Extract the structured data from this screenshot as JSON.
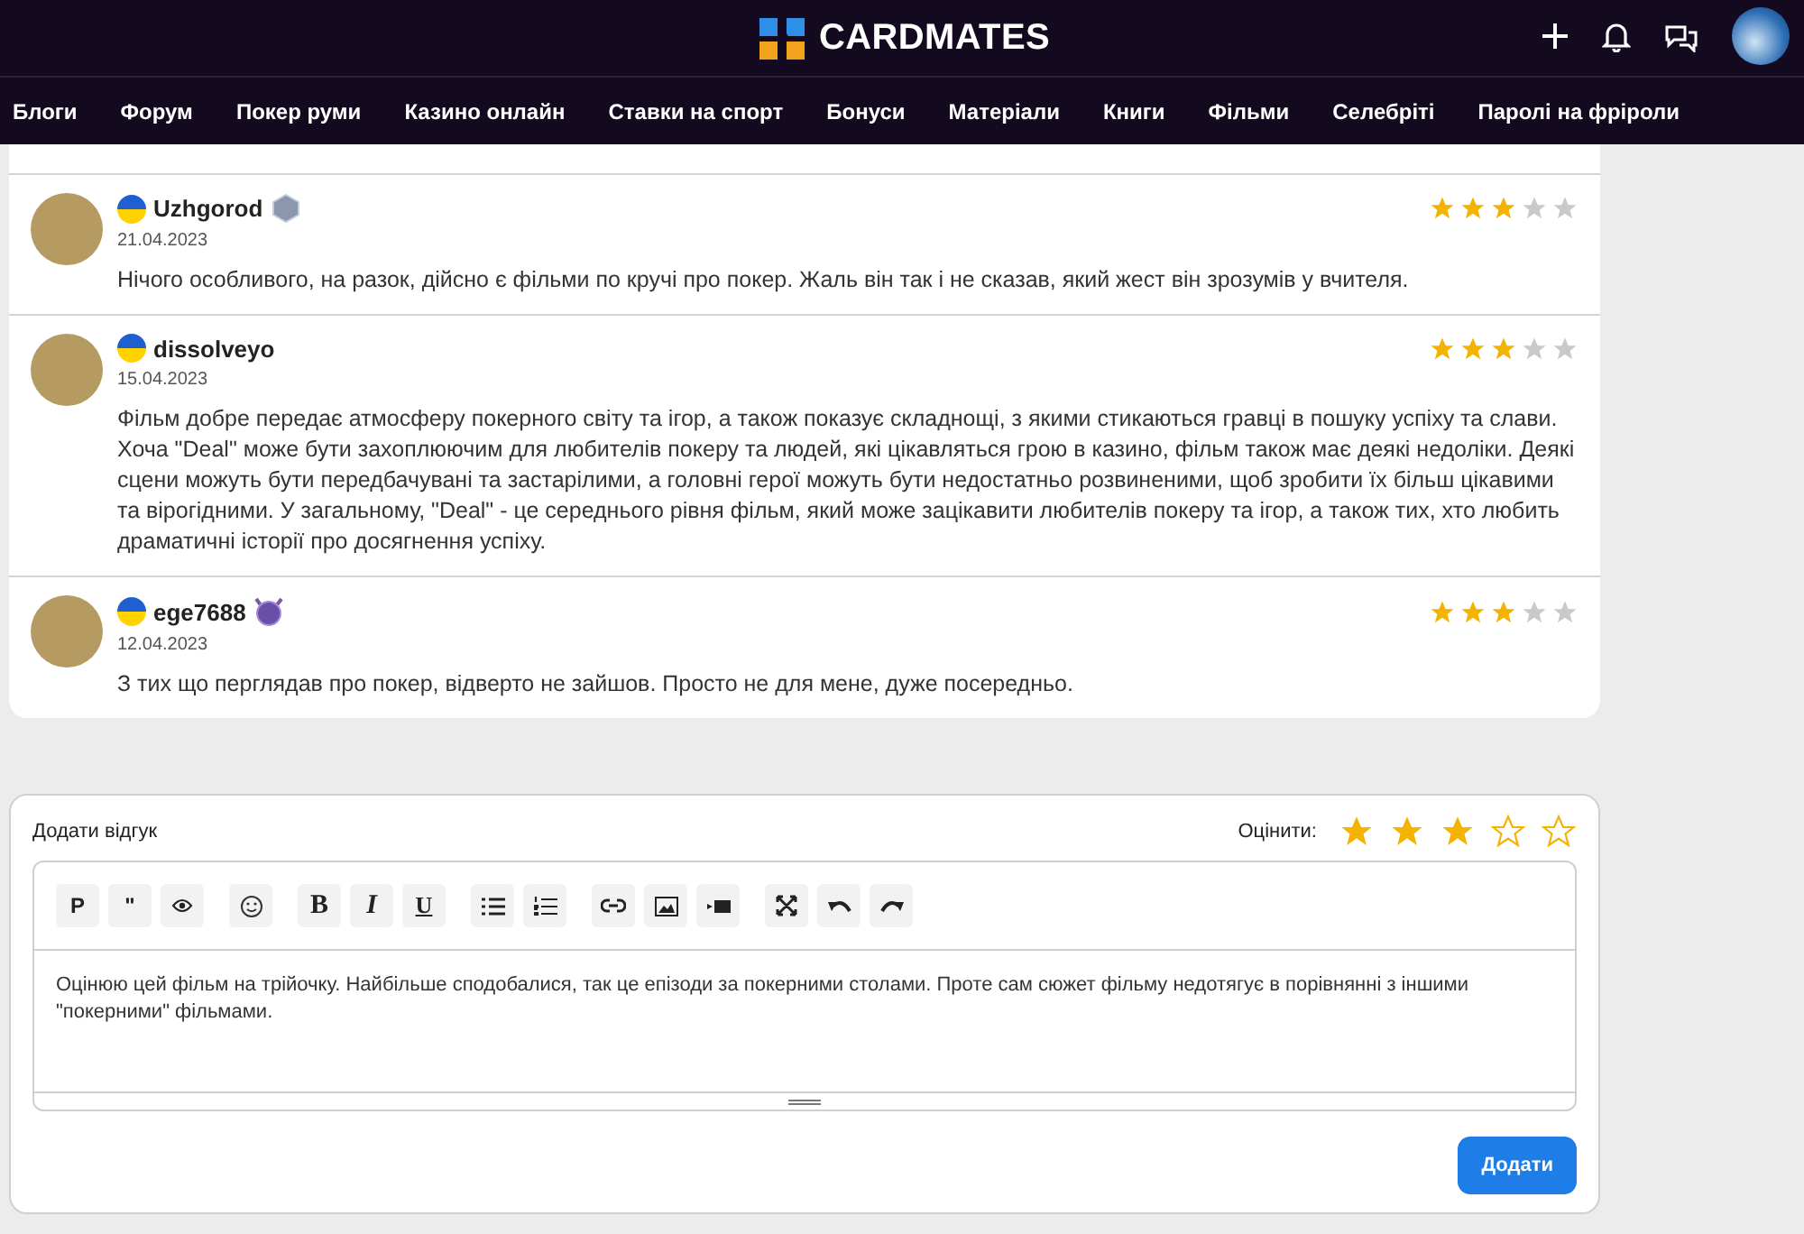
{
  "header": {
    "brand": "CARDMATES"
  },
  "nav": [
    "Блоги",
    "Форум",
    "Покер руми",
    "Казино онлайн",
    "Ставки на спорт",
    "Бонуси",
    "Матеріали",
    "Книги",
    "Фільми",
    "Селебріті",
    "Паролі на фріроли"
  ],
  "reviews": [
    {
      "name": "Uzhgorod",
      "badges": [
        {
          "kind": "shield"
        }
      ],
      "date": "21.04.2023",
      "stars": 3,
      "text": "Нічого особливого, на разок, дійсно є фільми по кручі про покер. Жаль він так і не сказав, який жест він зрозумів у вчителя."
    },
    {
      "name": "dissolveyo",
      "date": "15.04.2023",
      "stars": 3,
      "text": "Фільм добре передає атмосферу покерного світу та ігор, а також показує складнощі, з якими стикаються гравці в пошуку успіху та слави. Хоча \"Deal\" може бути захоплюючим для любителів покеру та людей, які цікавляться грою в казино, фільм також має деякі недоліки. Деякі сцени можуть бути передбачувані та застарілими, а головні герої можуть бути недостатньо розвиненими, щоб зробити їх більш цікавими та вірогідними. У загальному, \"Deal\" - це середнього рівня фільм, який може зацікавити любителів покеру та ігор, а також тих, хто любить драматичні історії про досягнення успіху."
    },
    {
      "name": "ege7688",
      "badges": [
        {
          "kind": "emblem"
        }
      ],
      "date": "12.04.2023",
      "stars": 3,
      "text": "З тих що перглядав про покер, відверто не зайшов. Просто не для мене, дуже посередньо."
    }
  ],
  "review_form": {
    "title": "Додати відгук",
    "rating_label": "Оцінити:",
    "stars": 3,
    "toolbar": [
      [
        {
          "kind": "plain",
          "label": "P"
        },
        {
          "kind": "plain",
          "label": "\""
        },
        {
          "kind": "eye"
        }
      ],
      [
        {
          "kind": "smiley"
        }
      ],
      [
        {
          "kind": "bold",
          "label": "B"
        },
        {
          "kind": "italic",
          "label": "I"
        },
        {
          "kind": "underline",
          "label": "U"
        }
      ],
      [
        {
          "kind": "bullet-list"
        },
        {
          "kind": "numbered-list"
        }
      ],
      [
        {
          "kind": "link"
        },
        {
          "kind": "image"
        },
        {
          "kind": "video"
        }
      ],
      [
        {
          "kind": "expand"
        },
        {
          "kind": "undo"
        },
        {
          "kind": "redo"
        }
      ]
    ],
    "value": "Оцінюю цей фільм на трійочку. Найбільше сподобалися, так це епізоди за покерними столами. Проте сам сюжет фільму недотягує в порівнянні з іншими \"покерними\" фільмами.",
    "submit": "Додати"
  }
}
